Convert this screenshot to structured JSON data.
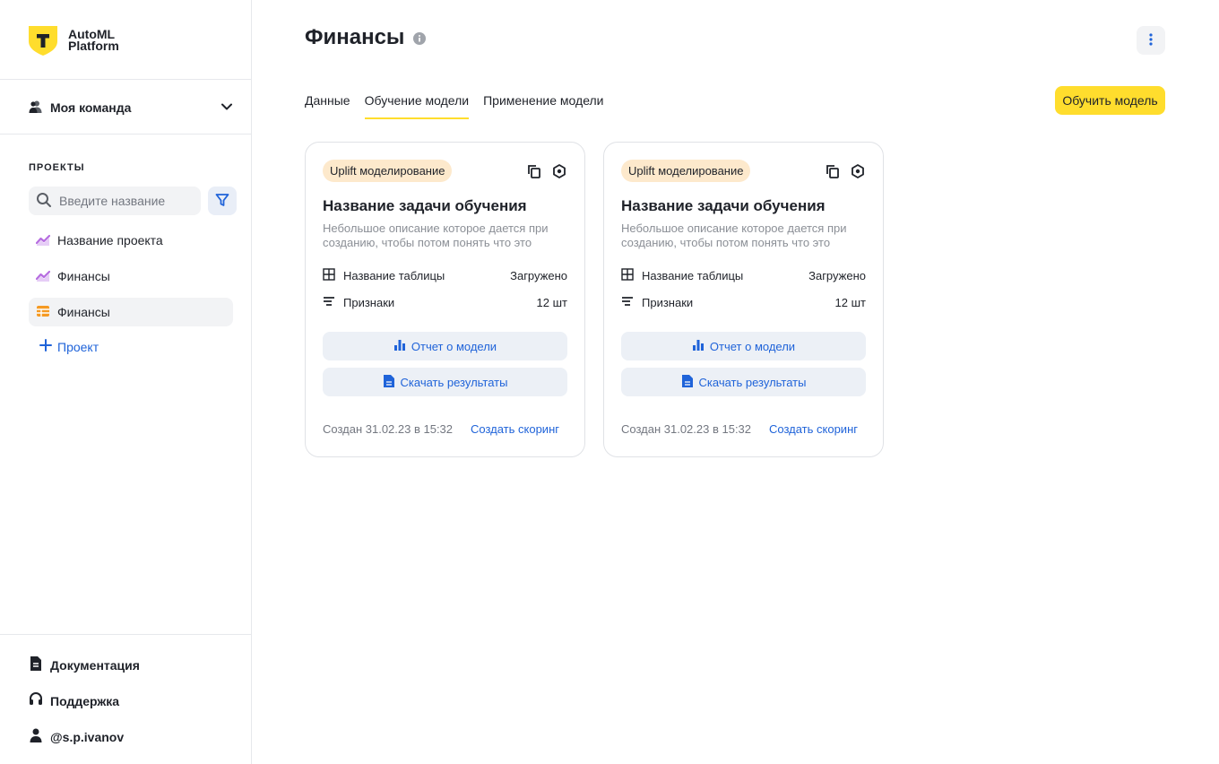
{
  "app": {
    "logo_line1": "AutoML",
    "logo_line2": "Platform",
    "logo_mark": "Т"
  },
  "sidebar": {
    "team_label": "Моя команда",
    "projects_title": "ПРОЕКТЫ",
    "search_placeholder": "Введите название",
    "items": [
      {
        "label": "Название проекта",
        "icon": "chart-line-icon"
      },
      {
        "label": "Финансы",
        "icon": "chart-line-icon"
      },
      {
        "label": "Финансы",
        "icon": "table-icon",
        "active": true
      }
    ],
    "add_project_label": "Проект",
    "bottom": {
      "docs_label": "Документация",
      "support_label": "Поддержка",
      "user_label": "@s.p.ivanov"
    }
  },
  "header": {
    "title": "Финансы",
    "tabs": [
      {
        "label": "Данные"
      },
      {
        "label": "Обучение модели",
        "active": true
      },
      {
        "label": "Применение модели"
      }
    ],
    "train_button_label": "Обучить модель"
  },
  "cards": [
    {
      "badge": "Uplift моделирование",
      "title": "Название задачи обучения",
      "description": "Небольшое описание которое дается при созданию, чтобы потом понять что это",
      "table_label": "Название таблицы",
      "table_status": "Загружено",
      "features_label": "Признаки",
      "features_count": "12 шт",
      "report_button": "Отчет о модели",
      "download_button": "Скачать результаты",
      "created": "Создан 31.02.23 в 15:32",
      "scoring_link": "Создать скоринг"
    },
    {
      "badge": "Uplift моделирование",
      "title": "Название задачи обучения",
      "description": "Небольшое описание которое дается при созданию, чтобы потом понять что это",
      "table_label": "Название таблицы",
      "table_status": "Загружено",
      "features_label": "Признаки",
      "features_count": "12 шт",
      "report_button": "Отчет о модели",
      "download_button": "Скачать результаты",
      "created": "Создан 31.02.23 в 15:32",
      "scoring_link": "Создать скоринг"
    }
  ],
  "colors": {
    "accent_yellow": "#ffdd2d",
    "link_blue": "#1f63d9",
    "badge_bg": "#fde9cc",
    "chart_icon_purple": "#b66de0",
    "table_icon_orange": "#f59a23"
  }
}
